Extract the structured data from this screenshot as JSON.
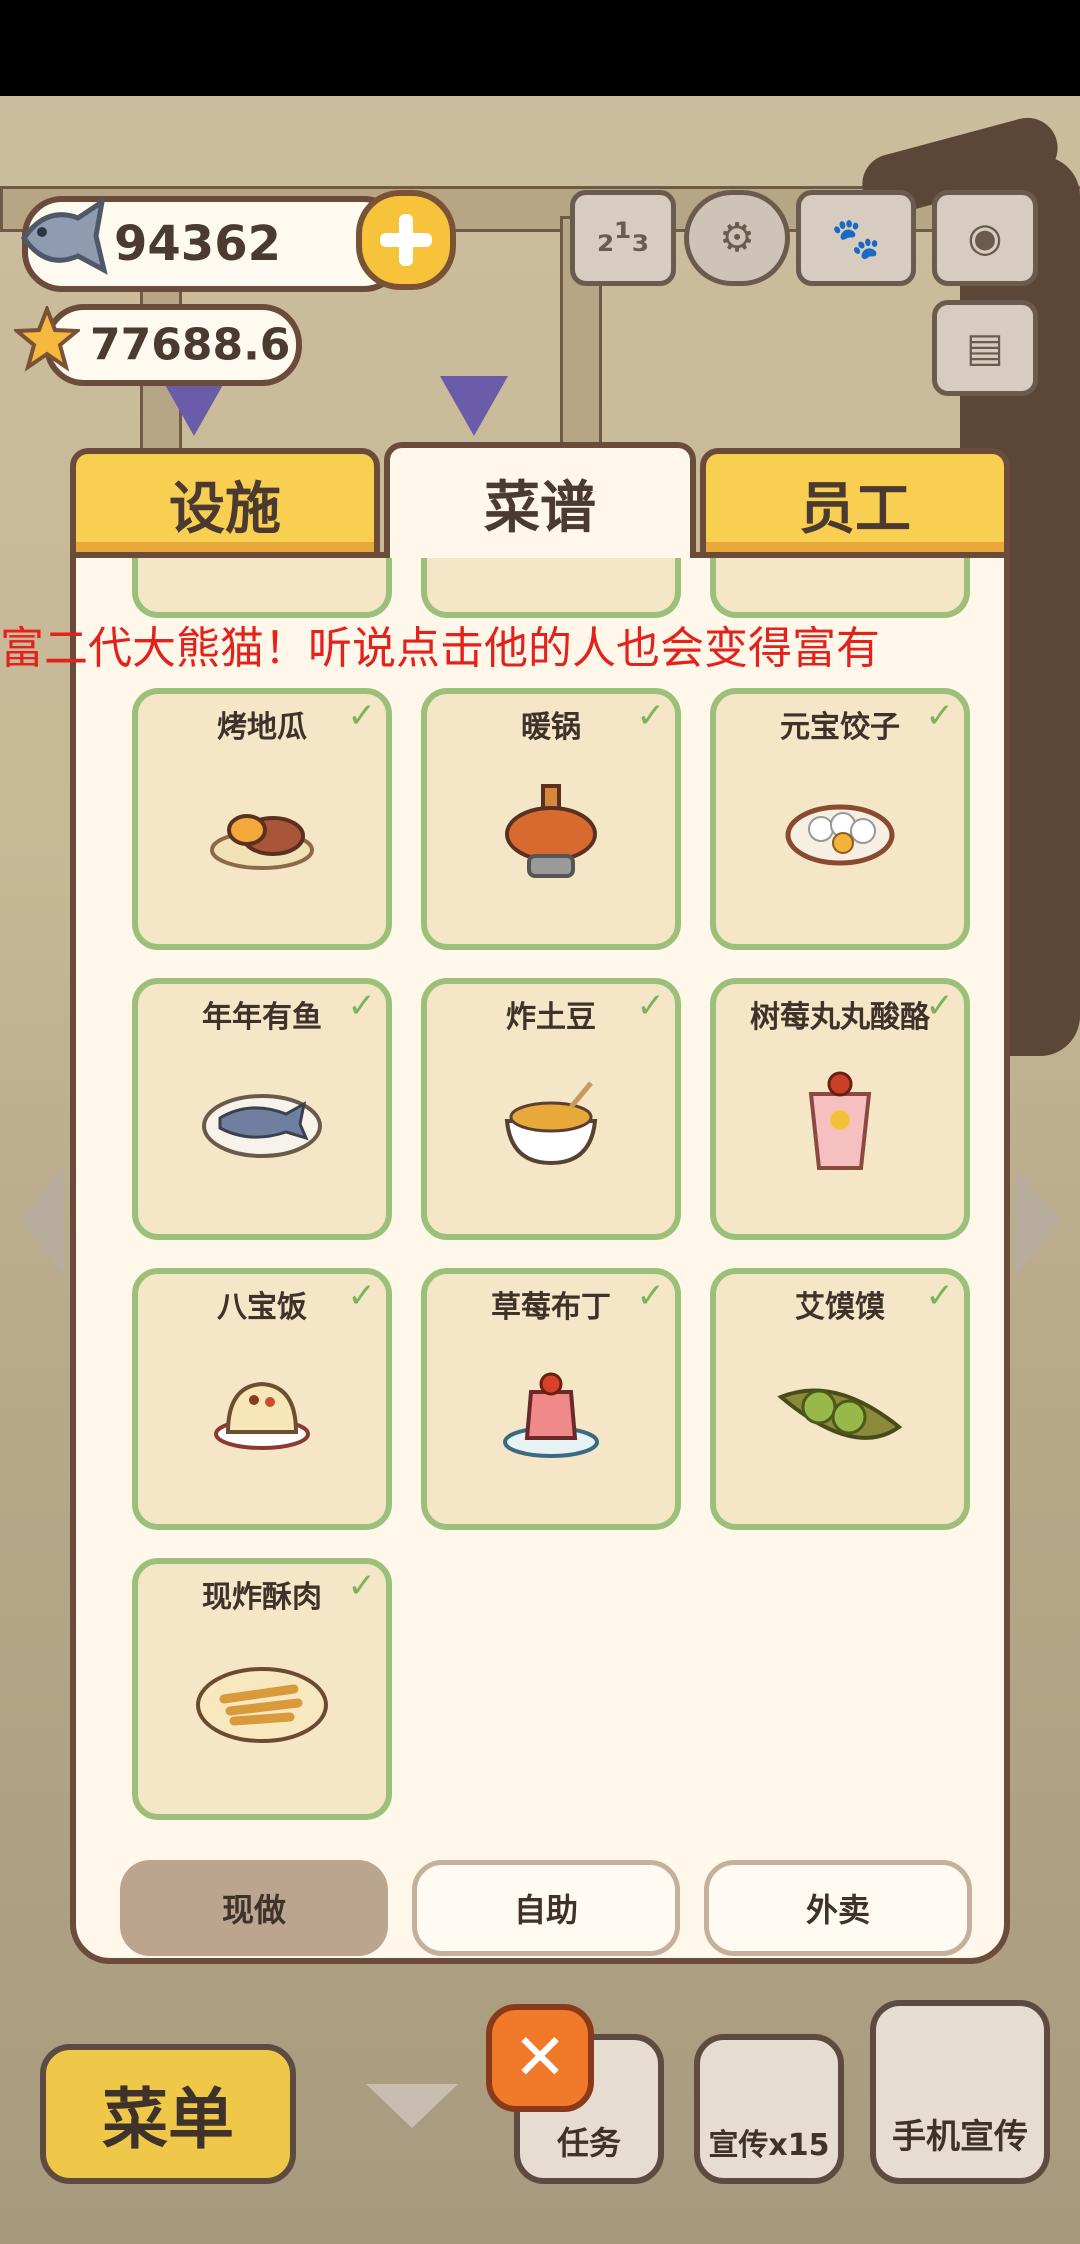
{
  "hud": {
    "fish_count": "94362",
    "star_count": "77688.6",
    "icons": [
      "fish-icon",
      "plus-icon",
      "star-icon",
      "leaderboard-icon",
      "settings-gear-icon",
      "paw-book-icon",
      "camera-icon",
      "postcard-icon"
    ]
  },
  "tabs": [
    {
      "label": "设施",
      "active": false
    },
    {
      "label": "菜谱",
      "active": true
    },
    {
      "label": "员工",
      "active": false
    }
  ],
  "marquee": "富二代大熊猫！听说点击他的人也会变得富有",
  "recipes": [
    {
      "name": "烤地瓜",
      "icon": "roasted-sweet-potato-icon"
    },
    {
      "name": "暖锅",
      "icon": "hot-pot-icon"
    },
    {
      "name": "元宝饺子",
      "icon": "dumplings-icon"
    },
    {
      "name": "年年有鱼",
      "icon": "fish-dish-icon"
    },
    {
      "name": "炸土豆",
      "icon": "fried-potato-icon"
    },
    {
      "name": "树莓丸丸酸酪",
      "icon": "raspberry-yogurt-icon"
    },
    {
      "name": "八宝饭",
      "icon": "eight-treasure-rice-icon"
    },
    {
      "name": "草莓布丁",
      "icon": "strawberry-pudding-icon"
    },
    {
      "name": "艾馍馍",
      "icon": "mugwort-bun-icon"
    },
    {
      "name": "现炸酥肉",
      "icon": "fried-crispy-pork-icon"
    }
  ],
  "modes": [
    {
      "label": "现做",
      "selected": true
    },
    {
      "label": "自助",
      "selected": false
    },
    {
      "label": "外卖",
      "selected": false
    }
  ],
  "bottom": {
    "menu_label": "菜单",
    "task_label": "任务",
    "promo_label": "宣传x15",
    "phone_promo_label": "手机宣传"
  },
  "colors": {
    "tab_yellow": "#f9cf52",
    "panel_bg": "#fff7ea",
    "card_bg": "#f5e6c8",
    "card_border": "#9cc07a",
    "marquee_red": "#e2221b",
    "close_orange": "#f07a2a"
  }
}
